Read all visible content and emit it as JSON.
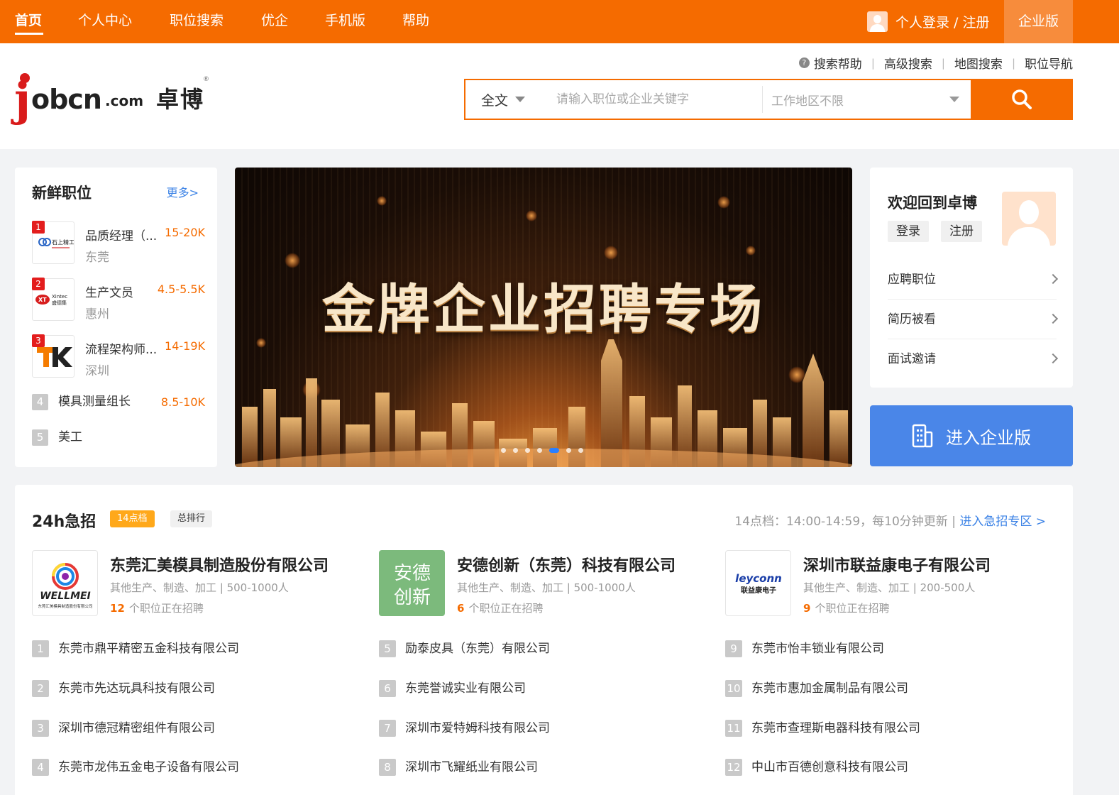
{
  "nav": {
    "items": [
      "首页",
      "个人中心",
      "职位搜索",
      "优企",
      "手机版",
      "帮助"
    ],
    "login": "个人登录 / 注册",
    "enterprise": "企业版"
  },
  "logo": {
    "domain_main": "jobcn",
    "domain_suffix": ".com",
    "cn_name": "卓博",
    "reg": "®"
  },
  "toplinks": [
    "搜索帮助",
    "高级搜索",
    "地图搜索",
    "职位导航"
  ],
  "search": {
    "type": "全文",
    "keyword_placeholder": "请输入职位或企业关键字",
    "area": "工作地区不限"
  },
  "fresh": {
    "title": "新鲜职位",
    "more": "更多>",
    "jobs": [
      {
        "rank": "1",
        "name": "品质经理（...",
        "salary": "15-20K",
        "city": "东莞",
        "logo_text": "石上精工"
      },
      {
        "rank": "2",
        "name": "生产文员",
        "salary": "4.5-5.5K",
        "city": "惠州",
        "logo_text": "Xintec 盛德集"
      },
      {
        "rank": "3",
        "name": "流程架构师...",
        "salary": "14-19K",
        "city": "深圳",
        "logo_text": "TK"
      },
      {
        "rank": "4",
        "name": "模具测量组长",
        "salary": "8.5-10K"
      },
      {
        "rank": "5",
        "name": "美工",
        "salary": ""
      }
    ]
  },
  "banner": {
    "headline": "金牌企业招聘专场",
    "slides": 7,
    "active_slide": 5
  },
  "welcome": {
    "title": "欢迎回到卓博",
    "login": "登录",
    "register": "注册",
    "menu": [
      "应聘职位",
      "简历被看",
      "面试邀请"
    ]
  },
  "enter_enterprise": "进入企业版",
  "urgent": {
    "title": "24h急招",
    "tag_time": "14点档",
    "tag_rank": "总排行",
    "info": "14点档：14:00-14:59，每10分钟更新 |",
    "info_link": "进入急招专区 >",
    "featured": [
      {
        "name": "东莞汇美模具制造股份有限公司",
        "meta": "其他生产、制造、加工 | 500-1000人",
        "jobs": "12",
        "jobs_suffix": "个职位正在招聘",
        "logo_text": "WELLMEI",
        "logo_sub": "东莞汇美模具制造股份有限公司"
      },
      {
        "name": "安德创新（东莞）科技有限公司",
        "meta": "其他生产、制造、加工 | 500-1000人",
        "jobs": "6",
        "jobs_suffix": "个职位正在招聘",
        "logo_text": "安德",
        "logo_sub": "创新"
      },
      {
        "name": "深圳市联益康电子有限公司",
        "meta": "其他生产、制造、加工 | 200-500人",
        "jobs": "9",
        "jobs_suffix": "个职位正在招聘",
        "logo_text": "leyconn",
        "logo_sub": "联益康电子"
      }
    ],
    "companies": [
      {
        "n": "1",
        "name": "东莞市鼎平精密五金科技有限公司"
      },
      {
        "n": "2",
        "name": "东莞市先达玩具科技有限公司"
      },
      {
        "n": "3",
        "name": "深圳市德冠精密组件有限公司"
      },
      {
        "n": "4",
        "name": "东莞市龙伟五金电子设备有限公司"
      },
      {
        "n": "5",
        "name": "励泰皮具（东莞）有限公司"
      },
      {
        "n": "6",
        "name": "东莞誉诚实业有限公司"
      },
      {
        "n": "7",
        "name": "深圳市爱特姆科技有限公司"
      },
      {
        "n": "8",
        "name": "深圳市飞耀纸业有限公司"
      },
      {
        "n": "9",
        "name": "东莞市怡丰锁业有限公司"
      },
      {
        "n": "10",
        "name": "东莞市惠加金属制品有限公司"
      },
      {
        "n": "11",
        "name": "东莞市查理斯电器科技有限公司"
      },
      {
        "n": "12",
        "name": "中山市百德创意科技有限公司"
      }
    ]
  },
  "colors": {
    "brand": "#f56b00",
    "link": "#3b82e6",
    "enterprise_btn": "#4a86e8",
    "salary": "#f56b00"
  }
}
